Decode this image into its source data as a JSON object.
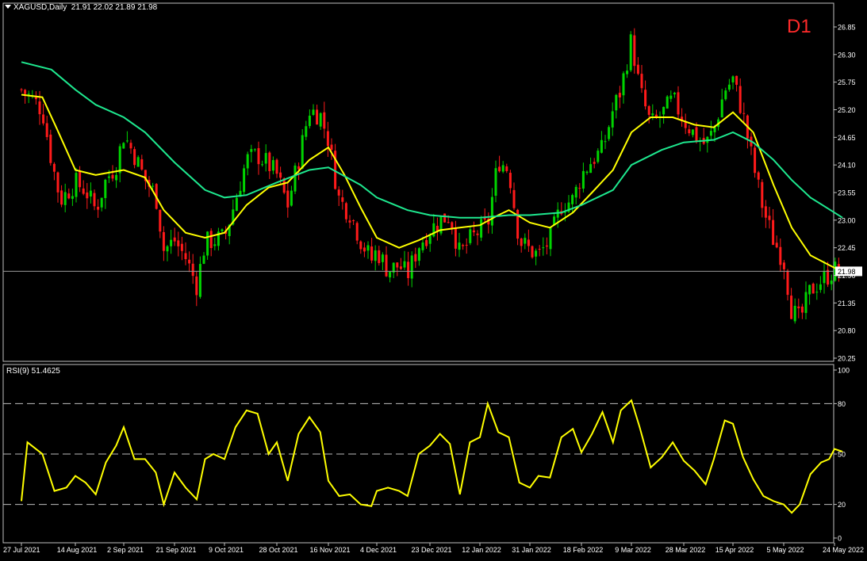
{
  "header": {
    "symbol_line": "XAGUSD,Daily  21.91 22.02 21.89 21.98",
    "timeframe_badge": "D1"
  },
  "rsi_panel": {
    "title": "RSI(9) 51.4625"
  },
  "colors": {
    "background": "#000000",
    "bull_candle": "#00d400",
    "bear_candle": "#ff1a1a",
    "ma_fast": "#ffff00",
    "ma_slow": "#1ee88f",
    "rsi_line": "#ffff00",
    "grid_text": "#ffffff",
    "frame": "#c0c0c0"
  },
  "chart_data": [
    {
      "type": "candlestick",
      "title": "XAGUSD,Daily",
      "ylim": [
        20.05,
        27.25
      ],
      "y_ticks": [
        "26.85",
        "26.30",
        "25.75",
        "25.20",
        "24.65",
        "24.10",
        "23.55",
        "23.00",
        "22.45",
        "21.90",
        "21.35",
        "20.80",
        "20.25"
      ],
      "x_ticks": [
        "27 Jul 2021",
        "14 Aug 2021",
        "2 Sep 2021",
        "21 Sep 2021",
        "9 Oct 2021",
        "28 Oct 2021",
        "16 Nov 2021",
        "4 Dec 2021",
        "23 Dec 2021",
        "12 Jan 2022",
        "31 Jan 2022",
        "18 Feb 2022",
        "9 Mar 2022",
        "28 Mar 2022",
        "15 Apr 2022",
        "5 May 2022",
        "24 May 2022"
      ],
      "current_price_label": "21.98",
      "current_price": 21.98,
      "close_path": [
        [
          "27 Jul 2021",
          25.6
        ],
        [
          "30 Jul 2021",
          25.45
        ],
        [
          "3 Aug 2021",
          25.2
        ],
        [
          "6 Aug 2021",
          24.2
        ],
        [
          "9 Aug 2021",
          23.4
        ],
        [
          "14 Aug 2021",
          23.75
        ],
        [
          "18 Aug 2021",
          23.6
        ],
        [
          "22 Aug 2021",
          23.2
        ],
        [
          "26 Aug 2021",
          23.8
        ],
        [
          "30 Aug 2021",
          24.1
        ],
        [
          "2 Sep 2021",
          24.7
        ],
        [
          "6 Sep 2021",
          24.3
        ],
        [
          "10 Sep 2021",
          23.8
        ],
        [
          "14 Sep 2021",
          23.5
        ],
        [
          "17 Sep 2021",
          22.4
        ],
        [
          "21 Sep 2021",
          22.6
        ],
        [
          "25 Sep 2021",
          22.25
        ],
        [
          "29 Sep 2021",
          21.7
        ],
        [
          "2 Oct 2021",
          22.55
        ],
        [
          "5 Oct 2021",
          22.6
        ],
        [
          "9 Oct 2021",
          22.65
        ],
        [
          "13 Oct 2021",
          23.4
        ],
        [
          "17 Oct 2021",
          24.2
        ],
        [
          "21 Oct 2021",
          24.3
        ],
        [
          "25 Oct 2021",
          24.1
        ],
        [
          "28 Oct 2021",
          23.9
        ],
        [
          "1 Nov 2021",
          23.3
        ],
        [
          "5 Nov 2021",
          24.2
        ],
        [
          "9 Nov 2021",
          25.2
        ],
        [
          "13 Nov 2021",
          25.1
        ],
        [
          "16 Nov 2021",
          24.6
        ],
        [
          "20 Nov 2021",
          23.4
        ],
        [
          "24 Nov 2021",
          23.15
        ],
        [
          "28 Nov 2021",
          22.6
        ],
        [
          "2 Dec 2021",
          22.2
        ],
        [
          "4 Dec 2021",
          22.4
        ],
        [
          "8 Dec 2021",
          22.0
        ],
        [
          "12 Dec 2021",
          22.1
        ],
        [
          "15 Dec 2021",
          21.9
        ],
        [
          "19 Dec 2021",
          22.5
        ],
        [
          "23 Dec 2021",
          22.8
        ],
        [
          "27 Dec 2021",
          23.0
        ],
        [
          "31 Dec 2021",
          23.1
        ],
        [
          "4 Jan 2022",
          22.3
        ],
        [
          "8 Jan 2022",
          22.6
        ],
        [
          "12 Jan 2022",
          22.8
        ],
        [
          "15 Jan 2022",
          22.9
        ],
        [
          "19 Jan 2022",
          24.2
        ],
        [
          "23 Jan 2022",
          24.0
        ],
        [
          "27 Jan 2022",
          22.6
        ],
        [
          "31 Jan 2022",
          22.4
        ],
        [
          "3 Feb 2022",
          22.3
        ],
        [
          "7 Feb 2022",
          22.6
        ],
        [
          "11 Feb 2022",
          23.3
        ],
        [
          "15 Feb 2022",
          23.4
        ],
        [
          "18 Feb 2022",
          23.9
        ],
        [
          "22 Feb 2022",
          24.2
        ],
        [
          "26 Feb 2022",
          24.4
        ],
        [
          "2 Mar 2022",
          25.2
        ],
        [
          "5 Mar 2022",
          25.6
        ],
        [
          "9 Mar 2022",
          26.6
        ],
        [
          "12 Mar 2022",
          25.6
        ],
        [
          "16 Mar 2022",
          24.9
        ],
        [
          "20 Mar 2022",
          25.1
        ],
        [
          "24 Mar 2022",
          25.4
        ],
        [
          "28 Mar 2022",
          25.0
        ],
        [
          "1 Apr 2022",
          24.7
        ],
        [
          "5 Apr 2022",
          24.5
        ],
        [
          "8 Apr 2022",
          24.8
        ],
        [
          "12 Apr 2022",
          25.6
        ],
        [
          "15 Apr 2022",
          25.8
        ],
        [
          "19 Apr 2022",
          25.1
        ],
        [
          "23 Apr 2022",
          24.1
        ],
        [
          "27 Apr 2022",
          23.2
        ],
        [
          "1 May 2022",
          22.6
        ],
        [
          "5 May 2022",
          22.2
        ],
        [
          "8 May 2022",
          21.2
        ],
        [
          "11 May 2022",
          21.0
        ],
        [
          "15 May 2022",
          21.6
        ],
        [
          "19 May 2022",
          21.8
        ],
        [
          "24 May 2022",
          22.0
        ],
        [
          "27 May 2022",
          21.98
        ]
      ],
      "moving_averages": [
        {
          "color": "#ffff00",
          "values": [
            [
              "27 Jul 2021",
              25.5
            ],
            [
              "3 Aug 2021",
              25.45
            ],
            [
              "8 Aug 2021",
              24.8
            ],
            [
              "14 Aug 2021",
              24.0
            ],
            [
              "22 Aug 2021",
              23.9
            ],
            [
              "2 Sep 2021",
              24.0
            ],
            [
              "10 Sep 2021",
              23.85
            ],
            [
              "17 Sep 2021",
              23.2
            ],
            [
              "25 Sep 2021",
              22.75
            ],
            [
              "2 Oct 2021",
              22.65
            ],
            [
              "9 Oct 2021",
              22.75
            ],
            [
              "17 Oct 2021",
              23.3
            ],
            [
              "25 Oct 2021",
              23.65
            ],
            [
              "1 Nov 2021",
              23.75
            ],
            [
              "9 Nov 2021",
              24.2
            ],
            [
              "16 Nov 2021",
              24.45
            ],
            [
              "22 Nov 2021",
              23.9
            ],
            [
              "28 Nov 2021",
              23.25
            ],
            [
              "4 Dec 2021",
              22.65
            ],
            [
              "12 Dec 2021",
              22.45
            ],
            [
              "19 Dec 2021",
              22.6
            ],
            [
              "27 Dec 2021",
              22.8
            ],
            [
              "4 Jan 2022",
              22.85
            ],
            [
              "12 Jan 2022",
              22.9
            ],
            [
              "19 Jan 2022",
              23.1
            ],
            [
              "23 Jan 2022",
              23.2
            ],
            [
              "31 Jan 2022",
              22.95
            ],
            [
              "7 Feb 2022",
              22.85
            ],
            [
              "15 Feb 2022",
              23.15
            ],
            [
              "22 Feb 2022",
              23.55
            ],
            [
              "2 Mar 2022",
              24.0
            ],
            [
              "9 Mar 2022",
              24.75
            ],
            [
              "16 Mar 2022",
              25.05
            ],
            [
              "24 Mar 2022",
              25.05
            ],
            [
              "1 Apr 2022",
              24.9
            ],
            [
              "8 Apr 2022",
              24.85
            ],
            [
              "15 Apr 2022",
              25.15
            ],
            [
              "23 Apr 2022",
              24.75
            ],
            [
              "1 May 2022",
              23.7
            ],
            [
              "8 May 2022",
              22.85
            ],
            [
              "15 May 2022",
              22.3
            ],
            [
              "24 May 2022",
              22.05
            ],
            [
              "27 May 2022",
              21.98
            ]
          ]
        },
        {
          "color": "#1ee88f",
          "values": [
            [
              "27 Jul 2021",
              26.15
            ],
            [
              "6 Aug 2021",
              26.0
            ],
            [
              "14 Aug 2021",
              25.6
            ],
            [
              "22 Aug 2021",
              25.3
            ],
            [
              "2 Sep 2021",
              25.05
            ],
            [
              "10 Sep 2021",
              24.75
            ],
            [
              "21 Sep 2021",
              24.15
            ],
            [
              "2 Oct 2021",
              23.6
            ],
            [
              "9 Oct 2021",
              23.45
            ],
            [
              "17 Oct 2021",
              23.5
            ],
            [
              "28 Oct 2021",
              23.75
            ],
            [
              "9 Nov 2021",
              24.0
            ],
            [
              "16 Nov 2021",
              24.05
            ],
            [
              "28 Nov 2021",
              23.7
            ],
            [
              "4 Dec 2021",
              23.45
            ],
            [
              "15 Dec 2021",
              23.2
            ],
            [
              "23 Dec 2021",
              23.1
            ],
            [
              "4 Jan 2022",
              23.05
            ],
            [
              "12 Jan 2022",
              23.05
            ],
            [
              "23 Jan 2022",
              23.1
            ],
            [
              "31 Jan 2022",
              23.1
            ],
            [
              "11 Feb 2022",
              23.15
            ],
            [
              "18 Feb 2022",
              23.3
            ],
            [
              "2 Mar 2022",
              23.6
            ],
            [
              "9 Mar 2022",
              24.1
            ],
            [
              "20 Mar 2022",
              24.4
            ],
            [
              "28 Mar 2022",
              24.55
            ],
            [
              "8 Apr 2022",
              24.6
            ],
            [
              "15 Apr 2022",
              24.75
            ],
            [
              "23 Apr 2022",
              24.55
            ],
            [
              "1 May 2022",
              24.2
            ],
            [
              "8 May 2022",
              23.8
            ],
            [
              "15 May 2022",
              23.45
            ],
            [
              "24 May 2022",
              23.15
            ],
            [
              "27 May 2022",
              23.05
            ]
          ]
        }
      ]
    },
    {
      "type": "line",
      "title": "RSI(9) 51.4625",
      "ylim": [
        0,
        100
      ],
      "y_ticks": [
        "100",
        "80",
        "50",
        "20",
        "0"
      ],
      "levels": [
        80,
        50,
        20
      ],
      "series": [
        {
          "values": [
            [
              "27 Jul 2021",
              22
            ],
            [
              "29 Jul 2021",
              57
            ],
            [
              "3 Aug 2021",
              50
            ],
            [
              "7 Aug 2021",
              28
            ],
            [
              "11 Aug 2021",
              30
            ],
            [
              "14 Aug 2021",
              37
            ],
            [
              "18 Aug 2021",
              33
            ],
            [
              "22 Aug 2021",
              26
            ],
            [
              "26 Aug 2021",
              45
            ],
            [
              "30 Aug 2021",
              55
            ],
            [
              "2 Sep 2021",
              66
            ],
            [
              "6 Sep 2021",
              47
            ],
            [
              "10 Sep 2021",
              47
            ],
            [
              "14 Sep 2021",
              39
            ],
            [
              "17 Sep 2021",
              20
            ],
            [
              "21 Sep 2021",
              39
            ],
            [
              "25 Sep 2021",
              30
            ],
            [
              "29 Sep 2021",
              23
            ],
            [
              "2 Oct 2021",
              47
            ],
            [
              "5 Oct 2021",
              50
            ],
            [
              "9 Oct 2021",
              47
            ],
            [
              "13 Oct 2021",
              66
            ],
            [
              "17 Oct 2021",
              76
            ],
            [
              "21 Oct 2021",
              74
            ],
            [
              "25 Oct 2021",
              50
            ],
            [
              "28 Oct 2021",
              57
            ],
            [
              "1 Nov 2021",
              34
            ],
            [
              "5 Nov 2021",
              62
            ],
            [
              "9 Nov 2021",
              72
            ],
            [
              "13 Nov 2021",
              63
            ],
            [
              "16 Nov 2021",
              34
            ],
            [
              "20 Nov 2021",
              25
            ],
            [
              "24 Nov 2021",
              26
            ],
            [
              "28 Nov 2021",
              20
            ],
            [
              "2 Dec 2021",
              19
            ],
            [
              "4 Dec 2021",
              28
            ],
            [
              "8 Dec 2021",
              30
            ],
            [
              "12 Dec 2021",
              28
            ],
            [
              "15 Dec 2021",
              25
            ],
            [
              "19 Dec 2021",
              50
            ],
            [
              "23 Dec 2021",
              55
            ],
            [
              "27 Dec 2021",
              62
            ],
            [
              "31 Dec 2021",
              56
            ],
            [
              "4 Jan 2022",
              26
            ],
            [
              "8 Jan 2022",
              57
            ],
            [
              "12 Jan 2022",
              60
            ],
            [
              "15 Jan 2022",
              80
            ],
            [
              "19 Jan 2022",
              63
            ],
            [
              "23 Jan 2022",
              60
            ],
            [
              "27 Jan 2022",
              33
            ],
            [
              "31 Jan 2022",
              30
            ],
            [
              "3 Feb 2022",
              37
            ],
            [
              "7 Feb 2022",
              36
            ],
            [
              "11 Feb 2022",
              60
            ],
            [
              "15 Feb 2022",
              65
            ],
            [
              "18 Feb 2022",
              51
            ],
            [
              "22 Feb 2022",
              62
            ],
            [
              "26 Feb 2022",
              75
            ],
            [
              "2 Mar 2022",
              57
            ],
            [
              "5 Mar 2022",
              76
            ],
            [
              "9 Mar 2022",
              82
            ],
            [
              "12 Mar 2022",
              66
            ],
            [
              "16 Mar 2022",
              42
            ],
            [
              "20 Mar 2022",
              48
            ],
            [
              "24 Mar 2022",
              57
            ],
            [
              "28 Mar 2022",
              46
            ],
            [
              "1 Apr 2022",
              40
            ],
            [
              "5 Apr 2022",
              32
            ],
            [
              "8 Apr 2022",
              47
            ],
            [
              "12 Apr 2022",
              70
            ],
            [
              "15 Apr 2022",
              68
            ],
            [
              "19 Apr 2022",
              48
            ],
            [
              "23 Apr 2022",
              35
            ],
            [
              "27 Apr 2022",
              25
            ],
            [
              "1 May 2022",
              22
            ],
            [
              "5 May 2022",
              20
            ],
            [
              "8 May 2022",
              15
            ],
            [
              "11 May 2022",
              20
            ],
            [
              "15 May 2022",
              38
            ],
            [
              "19 May 2022",
              45
            ],
            [
              "22 May 2022",
              47
            ],
            [
              "24 May 2022",
              53
            ],
            [
              "27 May 2022",
              51.46
            ]
          ]
        }
      ]
    }
  ]
}
